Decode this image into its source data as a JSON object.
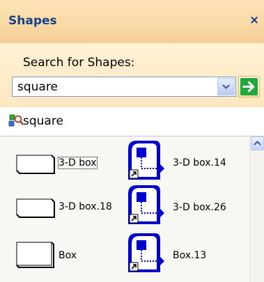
{
  "panel": {
    "title": "Shapes",
    "close_label": "×"
  },
  "search": {
    "label": "Search for Shapes:",
    "value": "square"
  },
  "results": {
    "query_label": "square"
  },
  "shapes": [
    {
      "label": "3-D box",
      "icon": "3d-box-shape-icon",
      "selected": true
    },
    {
      "label": "3-D box.14",
      "icon": "master-shortcut-icon"
    },
    {
      "label": "3-D box.18",
      "icon": "3d-box-shape-icon"
    },
    {
      "label": "3-D box.26",
      "icon": "master-shortcut-icon"
    },
    {
      "label": "Box",
      "icon": "box-shape-icon"
    },
    {
      "label": "Box.13",
      "icon": "master-shortcut-icon"
    }
  ],
  "colors": {
    "title_text": "#15428B",
    "header_bg": "#F8D8A4",
    "search_bg": "#FCE6BE",
    "go_arrow": "#1FA327",
    "stencil_bg": "#F7F7F4",
    "master_icon_blue": "#0000CC"
  }
}
